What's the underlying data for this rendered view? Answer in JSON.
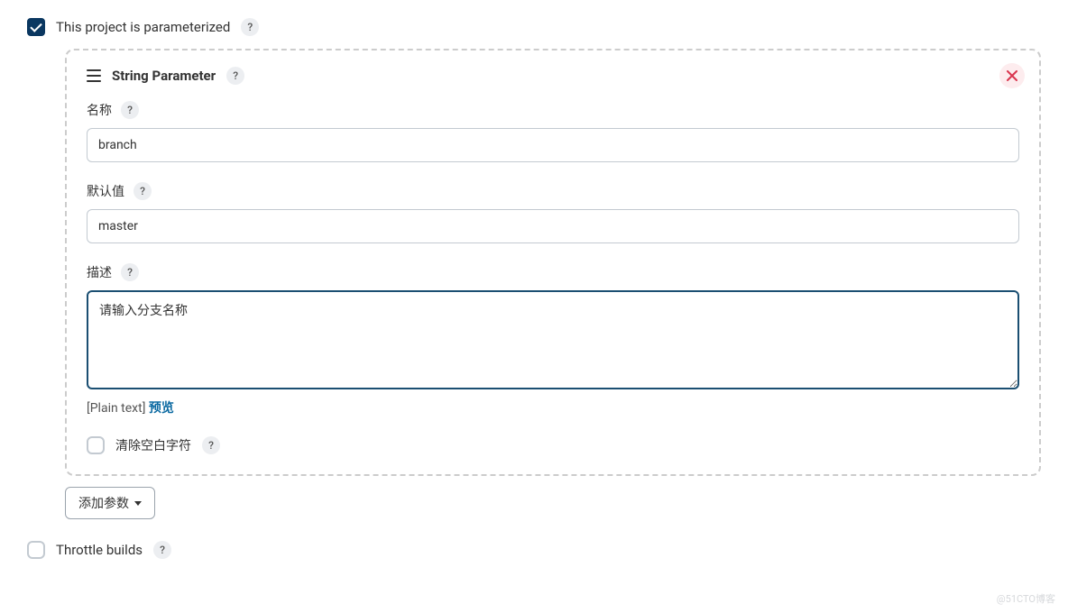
{
  "options": {
    "parameterized_label": "This project is parameterized",
    "throttle_label": "Throttle builds"
  },
  "parameter": {
    "type_label": "String Parameter",
    "name": {
      "label": "名称",
      "value": "branch"
    },
    "default": {
      "label": "默认值",
      "value": "master"
    },
    "description": {
      "label": "描述",
      "value": "请输入分支名称",
      "format_text": "[Plain text]",
      "preview_label": "预览"
    },
    "trim": {
      "label": "清除空白字符"
    }
  },
  "buttons": {
    "add_param": "添加参数"
  },
  "help_glyph": "?",
  "watermark": "@51CTO博客"
}
